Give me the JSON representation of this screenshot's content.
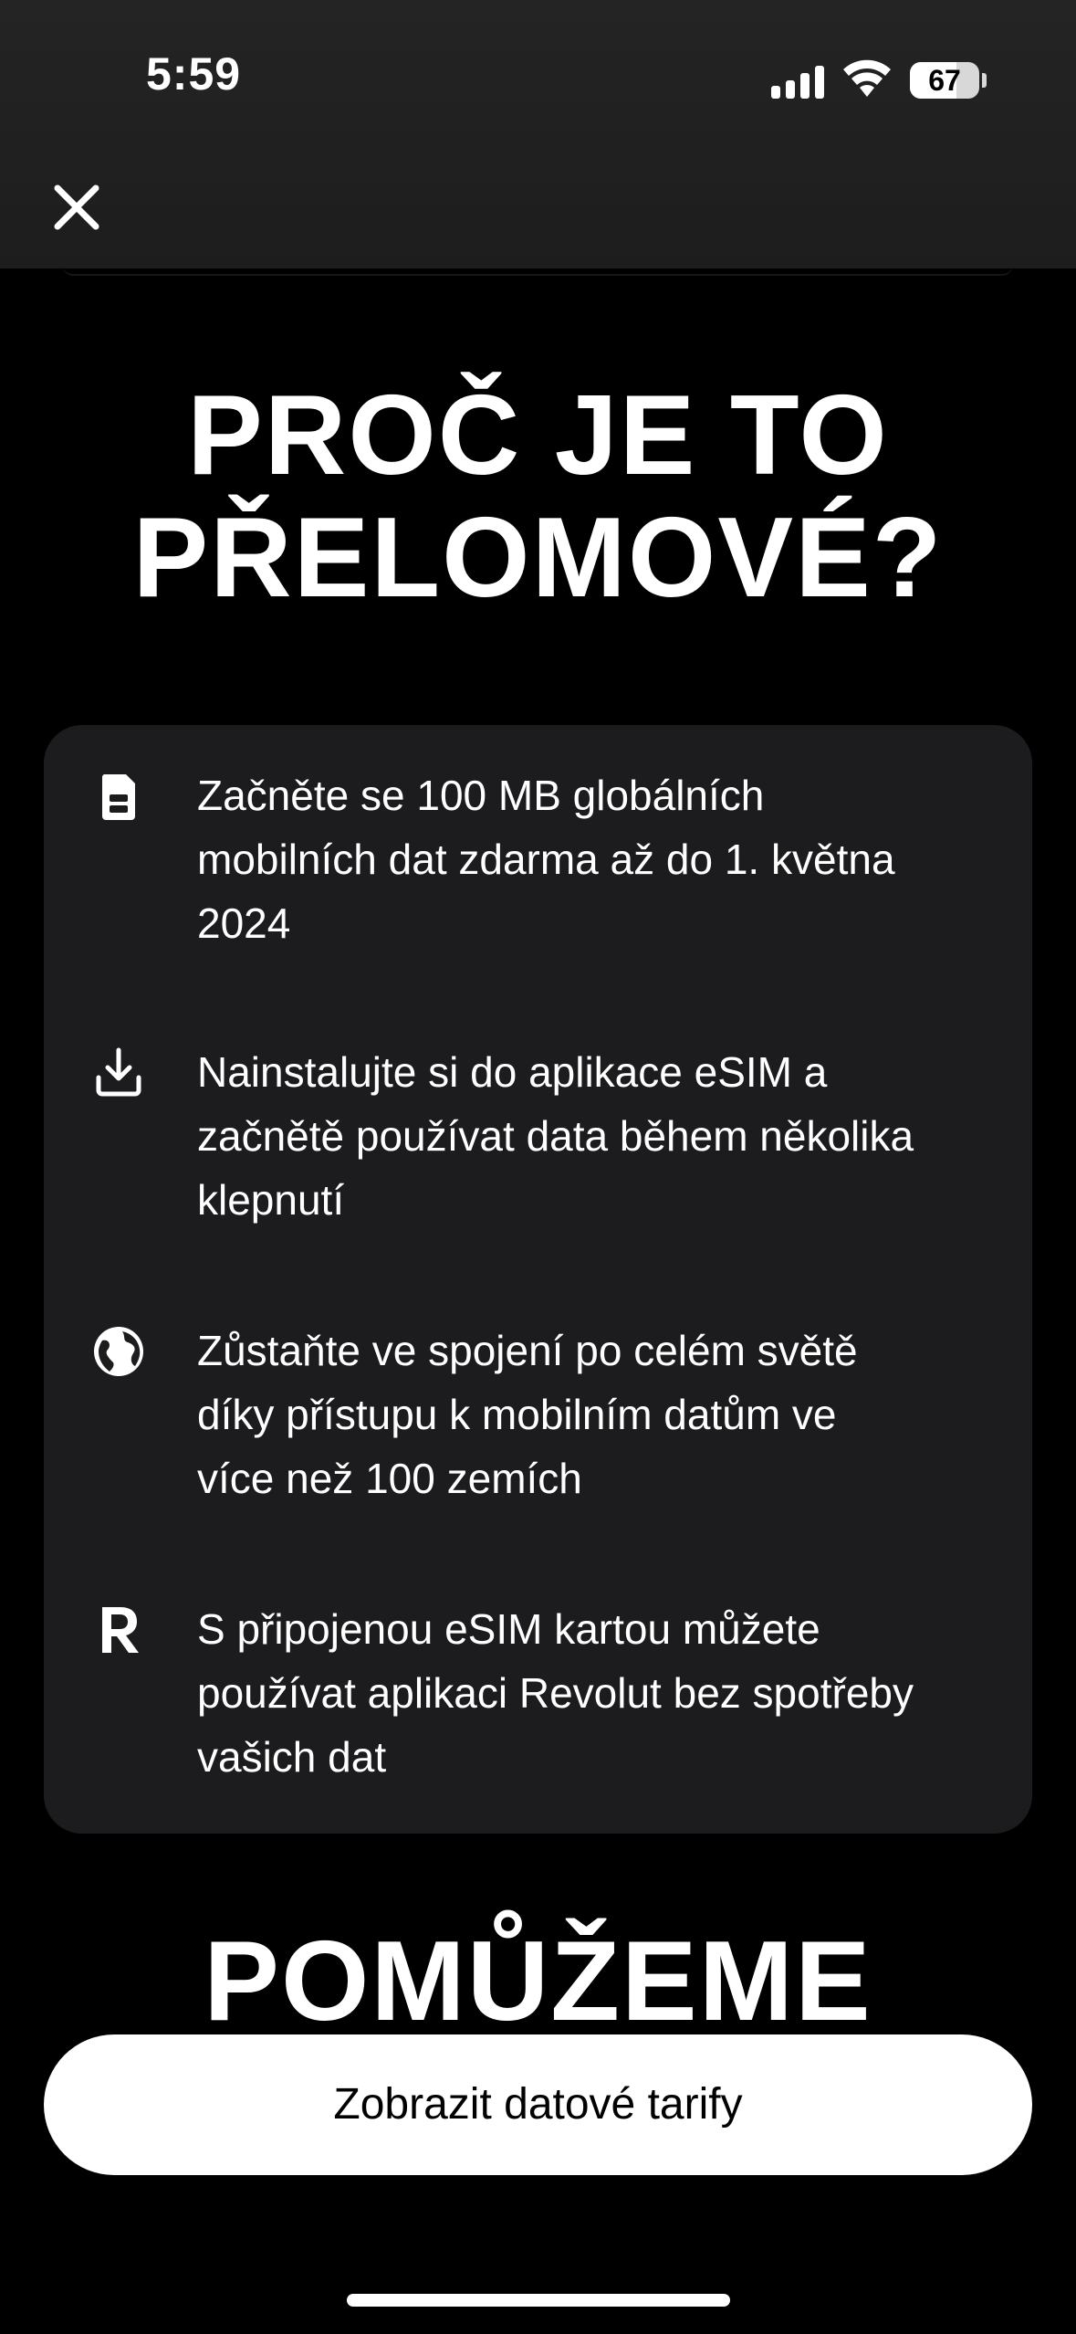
{
  "status": {
    "time": "5:59",
    "battery": "67",
    "battery_level": 0.67
  },
  "nav": {
    "close_icon": "close-icon"
  },
  "heading": {
    "line1": "PROČ JE TO",
    "line2": "PŘELOMOVÉ?"
  },
  "features": [
    {
      "icon": "sim-card-icon",
      "lines": [
        "Začněte se 100 MB globálních",
        "mobilních dat zdarma až do 1. května",
        "2024"
      ]
    },
    {
      "icon": "download-icon",
      "lines": [
        "Nainstalujte si do aplikace eSIM a",
        "začnětě používat data během několika",
        "klepnutí"
      ]
    },
    {
      "icon": "globe-icon",
      "lines": [
        "Zůstaňte ve spojení po celém světě",
        "díky přístupu k mobilním datům ve",
        "více než 100 zemích"
      ]
    },
    {
      "icon": "revolut-logo-icon",
      "lines": [
        "S připojenou eSIM kartou můžete",
        "používat aplikaci Revolut bez spotřeby",
        "vašich dat"
      ]
    }
  ],
  "heading2": "POMŮŽEME",
  "cta": {
    "label": "Zobrazit datové tarify"
  }
}
